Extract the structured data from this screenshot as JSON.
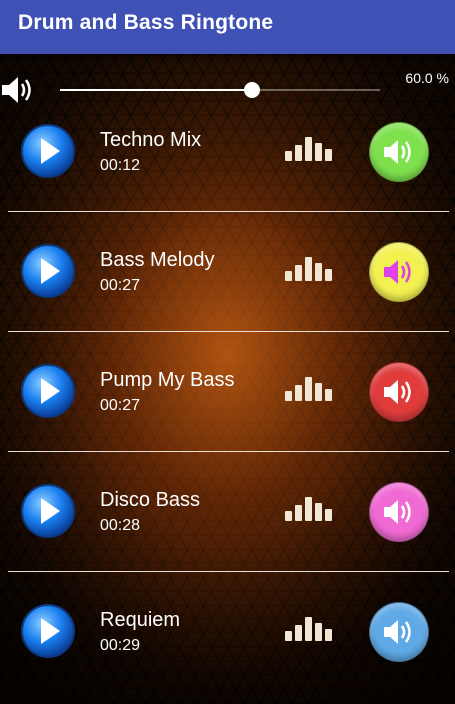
{
  "app": {
    "title": "Drum and Bass Ringtone"
  },
  "volume": {
    "percent_text": "60.0 %",
    "level": 0.6
  },
  "ringtones": [
    {
      "name": "Techno Mix",
      "duration": "00:12",
      "ring_color": "#7ee04c"
    },
    {
      "name": "Bass Melody",
      "duration": "00:27",
      "ring_color": "#f3f150"
    },
    {
      "name": "Pump My Bass",
      "duration": "00:27",
      "ring_color": "#e03c3c"
    },
    {
      "name": "Disco Bass",
      "duration": "00:28",
      "ring_color": "#f06ad3"
    },
    {
      "name": "Requiem",
      "duration": "00:29",
      "ring_color": "#5fa9e6"
    }
  ],
  "colors": {
    "appbar": "#3f51b5",
    "play_button": "#1a7ff0"
  }
}
